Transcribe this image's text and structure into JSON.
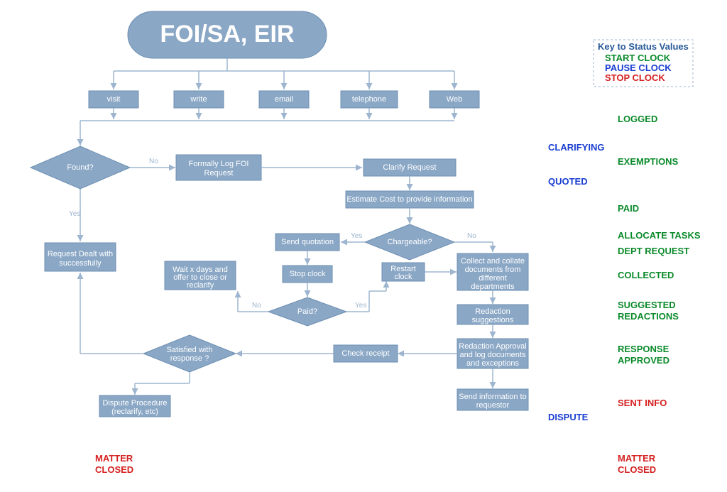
{
  "title": "FOI/SA, EIR",
  "intake": [
    "visit",
    "write",
    "email",
    "telephone",
    "Web"
  ],
  "nodes": {
    "found": "Found?",
    "log": "Formally Log FOI Request",
    "clarify": "Clarify Request",
    "estimate": "Estimate Cost to provide information",
    "chargeable": "Chargeable?",
    "quote": "Send quotation",
    "stopclock": "Stop clock",
    "restart": "Restart clock",
    "paid": "Paid?",
    "wait": "Wait x days and offer to close or reclarify",
    "dealt": "Request Dealt with successfully",
    "collect": "Collect and collate documents from different departments",
    "redaction": "Redaction suggestions",
    "approval": "Redaction Approval and log documents and exceptions",
    "send": "Send information to requestor",
    "check": "Check receipt",
    "satisfied": "Satisfied with response ?",
    "dispute": "Dispute Procedure (reclarify, etc)"
  },
  "edgeLabels": {
    "yes": "Yes",
    "no": "No"
  },
  "legend": {
    "title": "Key to Status Values",
    "start": "START CLOCK",
    "pause": "PAUSE CLOCK",
    "stop": "STOP CLOCK"
  },
  "status": {
    "logged": "LOGGED",
    "clarifying": "CLARIFYING",
    "exemptions": "EXEMPTIONS",
    "quoted": "QUOTED",
    "paid": "PAID",
    "allocate": "ALLOCATE TASKS",
    "deptreq": "DEPT REQUEST",
    "collected": "COLLECTED",
    "suggested1": "SUGGESTED",
    "suggested2": "REDACTIONS",
    "response1": "RESPONSE",
    "response2": "APPROVED",
    "sentinfo": "SENT INFO",
    "disputeS": "DISPUTE",
    "closed1": "MATTER",
    "closed2": "CLOSED"
  }
}
